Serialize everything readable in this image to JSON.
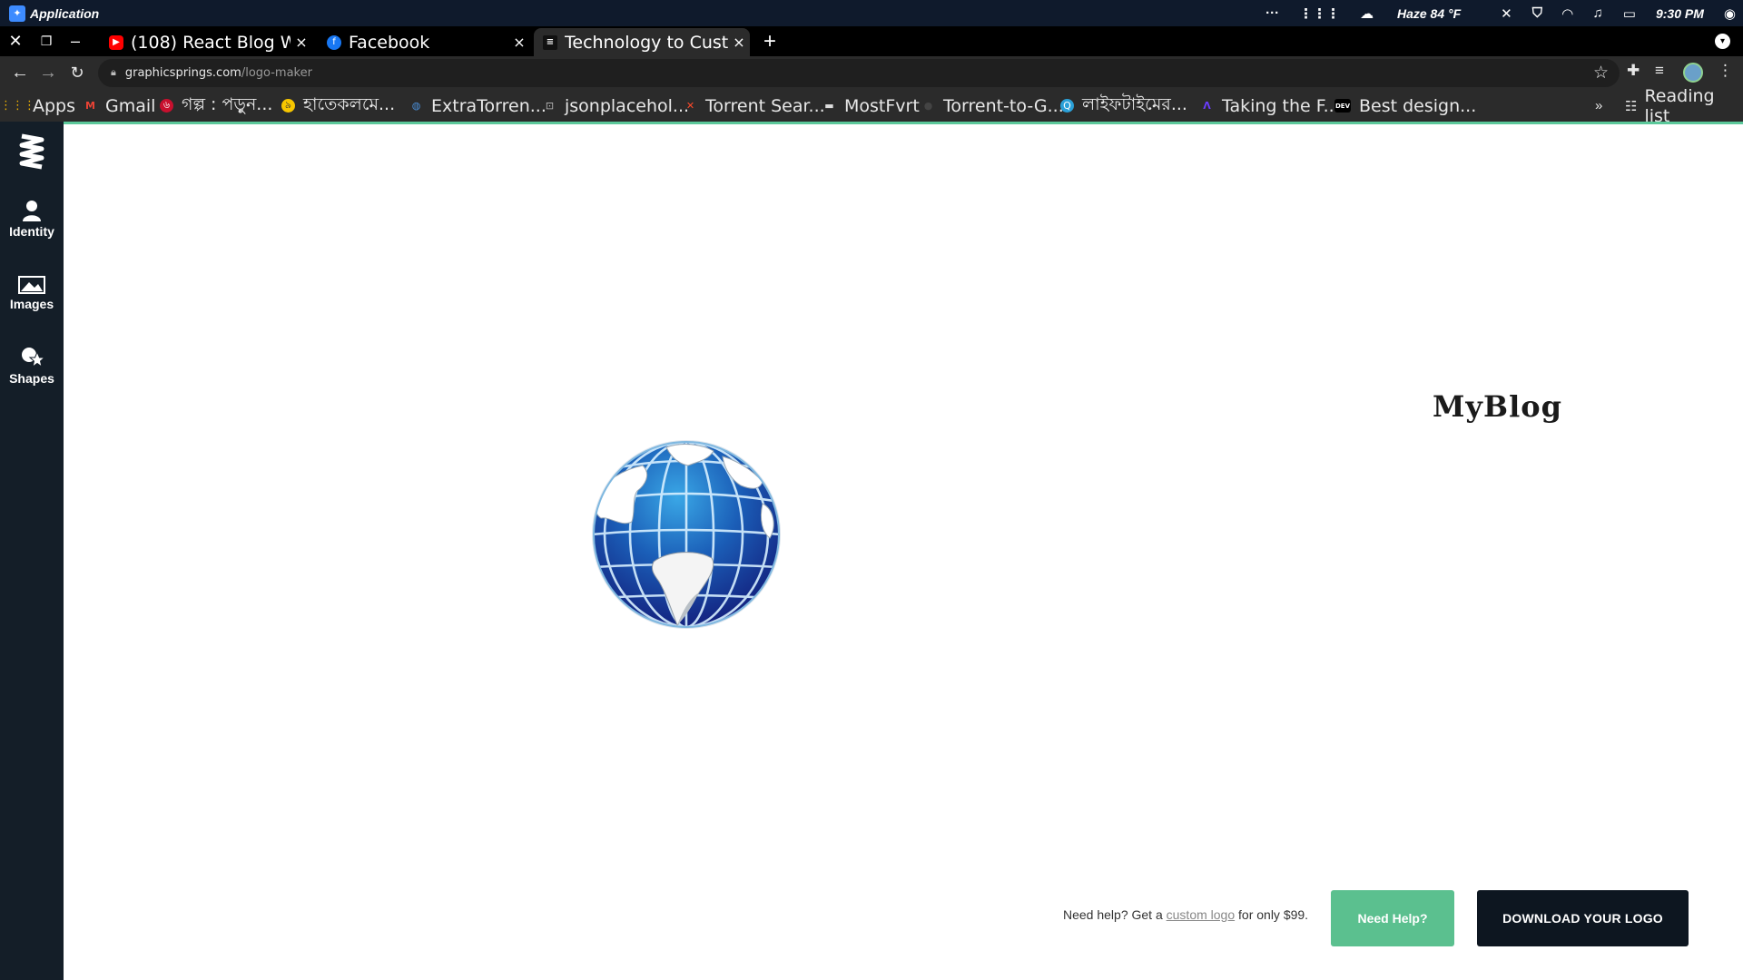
{
  "os": {
    "app_name": "Application",
    "weather": "Haze 84 °F",
    "time": "9:30 PM",
    "tray_icons": [
      "dots-icon",
      "grid-icon",
      "cloud-icon",
      "bluetooth-icon",
      "shield-icon",
      "wifi-icon",
      "music-icon",
      "battery-icon",
      "user-icon"
    ]
  },
  "browser": {
    "tabs": [
      {
        "title": "(108) React Blog Website",
        "favicon": "youtube-icon",
        "close": "×"
      },
      {
        "title": "Facebook",
        "favicon": "facebook-icon",
        "close": "×"
      },
      {
        "title": "Technology to Customize",
        "favicon": "graphicsprings-icon",
        "close": "×",
        "active": true
      }
    ],
    "new_tab": "+",
    "url_host": "graphicsprings.com",
    "url_path": "/logo-maker",
    "bookmarks": [
      {
        "label": "Apps",
        "icon": "apps-grid-icon"
      },
      {
        "label": "Gmail",
        "icon": "gmail-icon"
      },
      {
        "label": "গল্প : পড়ুন...",
        "icon": "red-circle-icon"
      },
      {
        "label": "হাতেকলমে...",
        "icon": "yellow-circle-icon"
      },
      {
        "label": "ExtraTorren...",
        "icon": "globe-icon"
      },
      {
        "label": "jsonplacehol...",
        "icon": "json-icon"
      },
      {
        "label": "Torrent Sear...",
        "icon": "x-icon"
      },
      {
        "label": "MostFvrt",
        "icon": "folder-icon"
      },
      {
        "label": "Torrent-to-G...",
        "icon": "github-icon"
      },
      {
        "label": "লাইফটাইমের...",
        "icon": "q-icon"
      },
      {
        "label": "Taking the F...",
        "icon": "a-icon"
      },
      {
        "label": "Best design...",
        "icon": "dev-icon"
      }
    ],
    "bookmarks_more": "»",
    "reading_list": "Reading list"
  },
  "sidebar": {
    "items": [
      {
        "label": "Identity",
        "icon": "person-icon"
      },
      {
        "label": "Images",
        "icon": "image-icon"
      },
      {
        "label": "Shapes",
        "icon": "shapes-icon"
      }
    ]
  },
  "canvas": {
    "logo_text": "MyBlog"
  },
  "footer": {
    "help_prefix": "Need help? Get a ",
    "help_link": "custom logo",
    "help_suffix": " for only $99.",
    "need_help_button": "Need Help?",
    "download_button": "DOWNLOAD YOUR LOGO"
  },
  "colors": {
    "sidebar_bg": "#141e28",
    "accent_green": "#5bc08f",
    "download_bg": "#0d1620"
  }
}
